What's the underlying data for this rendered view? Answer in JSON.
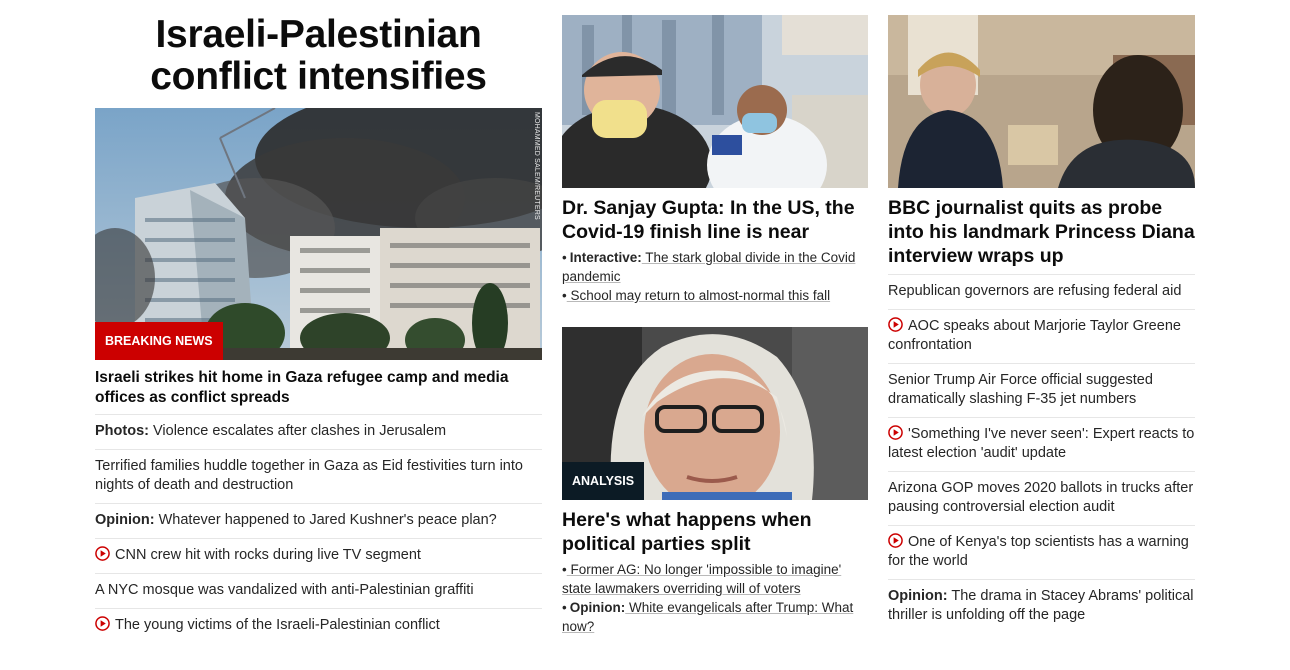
{
  "col1": {
    "headline": "Israeli-Palestinian conflict intensifies",
    "image_alt": "Smoke rises over buildings in Gaza",
    "credit": "MOHAMMED SALEM/REUTERS",
    "badge": "BREAKING NEWS",
    "lead": "Israeli strikes hit home in Gaza refugee camp and media offices as conflict spreads",
    "items": [
      {
        "kicker": "Photos:",
        "text": " Violence escalates after clashes in Jerusalem"
      },
      {
        "text": "Terrified families huddle together in Gaza as Eid festivities turn into nights of death and destruction"
      },
      {
        "kicker": "Opinion:",
        "text": " Whatever happened to Jared Kushner's peace plan?"
      },
      {
        "video": true,
        "text": "CNN crew hit with rocks during live TV segment"
      },
      {
        "text": "A NYC mosque was vandalized with anti-Palestinian graffiti"
      },
      {
        "video": true,
        "text": "The young victims of the Israeli-Palestinian conflict"
      }
    ]
  },
  "col2": {
    "story1": {
      "image_alt": "Man receiving Covid-19 vaccine",
      "title": "Dr. Sanjay Gupta: In the US, the Covid-19 finish line is near",
      "sub": [
        {
          "bullet": "•",
          "kicker": "Interactive:",
          "text": " The stark global divide in the Covid pandemic"
        },
        {
          "bullet": "•",
          "text": " School may return to almost-normal this fall"
        }
      ]
    },
    "story2": {
      "image_alt": "Liz Cheney",
      "badge": "ANALYSIS",
      "title": "Here's what happens when political parties split",
      "sub": [
        {
          "bullet": "•",
          "text": " Former AG: No longer 'impossible to imagine' state lawmakers overriding will of voters"
        },
        {
          "bullet": "•",
          "kicker": "Opinion:",
          "text": " White evangelicals after Trump: What now?"
        }
      ]
    }
  },
  "col3": {
    "image_alt": "Princess Diana interview",
    "title": "BBC journalist quits as probe into his landmark Princess Diana interview wraps up",
    "items": [
      {
        "text": "Republican governors are refusing federal aid"
      },
      {
        "video": true,
        "text": "AOC speaks about Marjorie Taylor Greene confrontation"
      },
      {
        "text": "Senior Trump Air Force official suggested dramatically slashing F-35 jet numbers"
      },
      {
        "video": true,
        "text": "'Something I've never seen': Expert reacts to latest election 'audit' update"
      },
      {
        "text": "Arizona GOP moves 2020 ballots in trucks after pausing controversial election audit"
      },
      {
        "video": true,
        "text": "One of Kenya's top scientists has a warning for the world"
      },
      {
        "kicker": "Opinion:",
        "text": " The drama in Stacey Abrams' political thriller is unfolding off the page"
      }
    ]
  },
  "colors": {
    "badge_red": "#cc0000",
    "badge_dark": "#0c1b25",
    "play_red": "#cc0000",
    "text": "#262626"
  }
}
